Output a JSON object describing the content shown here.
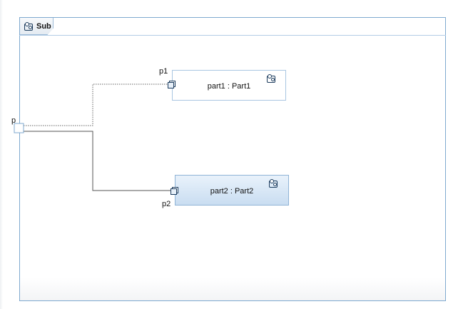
{
  "diagram": {
    "frame": {
      "title": "Sub",
      "icon": "component-icon"
    },
    "boundary_port": {
      "label": "p"
    },
    "parts": [
      {
        "id": "part1",
        "label": "part1 : Part1",
        "icon": "component-icon",
        "port_label": "p1",
        "selected": false
      },
      {
        "id": "part2",
        "label": "part2 : Part2",
        "icon": "component-icon",
        "port_label": "p2",
        "selected": true
      }
    ],
    "connectors": [
      {
        "from": "p",
        "to": "p1",
        "style": "dotted"
      },
      {
        "from": "p",
        "to": "p2",
        "style": "solid"
      }
    ],
    "colors": {
      "frame_border": "#7fa9cf",
      "part_fill_selected": "#c9ddf1",
      "connector": "#555555"
    }
  }
}
